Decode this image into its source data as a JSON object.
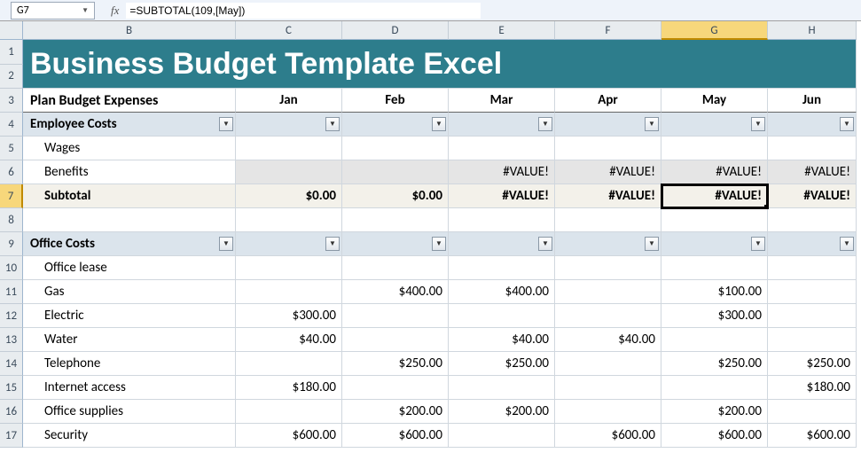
{
  "namebox": "G7",
  "formula": "=SUBTOTAL(109,[May])",
  "fx_label": "fx",
  "columns": [
    "B",
    "C",
    "D",
    "E",
    "F",
    "G",
    "H"
  ],
  "selected_col": "G",
  "selected_row": "7",
  "row_numbers": [
    "1",
    "2",
    "3",
    "4",
    "5",
    "6",
    "7",
    "8",
    "9",
    "10",
    "11",
    "12",
    "13",
    "14",
    "15",
    "16",
    "17"
  ],
  "title": "Business Budget Template Excel",
  "header_row": {
    "label": "Plan Budget Expenses",
    "months": [
      "Jan",
      "Feb",
      "Mar",
      "Apr",
      "May",
      "Jun"
    ]
  },
  "sections": [
    {
      "name": "Employee Costs"
    },
    {
      "name": "Office Costs"
    }
  ],
  "rows": {
    "wages": {
      "label": "Wages",
      "vals": [
        "",
        "",
        "",
        "",
        "",
        ""
      ]
    },
    "benefits": {
      "label": "Benefits",
      "vals": [
        "",
        "",
        "#VALUE!",
        "#VALUE!",
        "#VALUE!",
        "#VALUE!"
      ]
    },
    "subtotal": {
      "label": "Subtotal",
      "vals": [
        "$0.00",
        "$0.00",
        "#VALUE!",
        "#VALUE!",
        "#VALUE!",
        "#VALUE!"
      ]
    },
    "lease": {
      "label": "Office lease",
      "vals": [
        "",
        "",
        "",
        "",
        "",
        ""
      ]
    },
    "gas": {
      "label": "Gas",
      "vals": [
        "",
        "$400.00",
        "$400.00",
        "",
        "$100.00",
        ""
      ]
    },
    "electric": {
      "label": "Electric",
      "vals": [
        "$300.00",
        "",
        "",
        "",
        "$300.00",
        ""
      ]
    },
    "water": {
      "label": "Water",
      "vals": [
        "$40.00",
        "",
        "$40.00",
        "$40.00",
        "",
        ""
      ]
    },
    "telephone": {
      "label": "Telephone",
      "vals": [
        "",
        "$250.00",
        "$250.00",
        "",
        "$250.00",
        "$250.00"
      ]
    },
    "internet": {
      "label": "Internet access",
      "vals": [
        "$180.00",
        "",
        "",
        "",
        "",
        "$180.00"
      ]
    },
    "supplies": {
      "label": "Office supplies",
      "vals": [
        "",
        "$200.00",
        "$200.00",
        "",
        "$200.00",
        ""
      ]
    },
    "security": {
      "label": "Security",
      "vals": [
        "$600.00",
        "$600.00",
        "",
        "$600.00",
        "$600.00",
        "$600.00"
      ]
    }
  }
}
